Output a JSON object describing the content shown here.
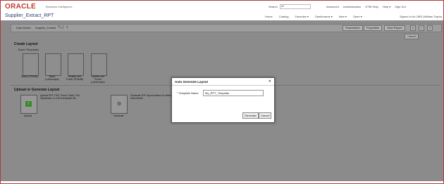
{
  "header": {
    "logo": "ORACLE",
    "product": "Business Intelligence",
    "search_label": "Search",
    "search_scope": "All",
    "links": [
      "Advanced",
      "Administration",
      "OTBI Help",
      "Help ▾",
      "Sign Out"
    ]
  },
  "titlebar": {
    "title": "Supplier_Extract_RPT",
    "nav": [
      "Home",
      "Catalog",
      "Favorites ▾",
      "Dashboards ▾",
      "New ▾",
      "Open ▾"
    ],
    "signed_in": "Signed In As  OBS (William Taylor)"
  },
  "editor": {
    "data_model_label": "Data Model",
    "data_model_name": "Supplier_Extract",
    "buttons": {
      "parameters": "Parameters",
      "properties": "Properties",
      "view_report": "View Report"
    },
    "cancel": "Cancel"
  },
  "create_layout": {
    "heading": "Create Layout",
    "basic_templates": "Basic Templates",
    "templates": [
      {
        "label": "Blank (Portrait)"
      },
      {
        "label": "Blank (Landscape)"
      },
      {
        "label": "Header and Footer (Portrait)"
      },
      {
        "label": "Header and Footer (Landscape)"
      }
    ]
  },
  "upload": {
    "heading": "Upload or Generate Layout",
    "upload_desc": "Upload RTF, PDF, Excel, Flash, XSL Stylesheet, or eText template file",
    "upload_label": "Upload",
    "generate_desc": "Generate RTF layout based on selected Data Model",
    "generate_label": "Generate"
  },
  "dialog": {
    "title": "Auto Generate Layout",
    "close": "✕",
    "field_label": "* Template Name",
    "template_name": "My_RPT_Template",
    "generate": "Generate",
    "cancel": "Cancel"
  }
}
